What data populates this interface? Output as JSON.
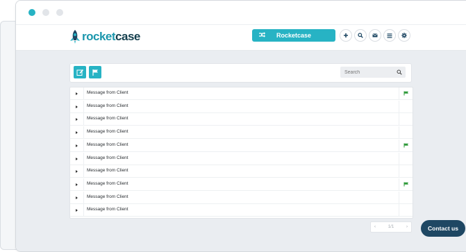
{
  "brand": {
    "logo_part1": "rocket",
    "logo_part2": "case",
    "accent": "#27b3c4",
    "dark": "#1e4763"
  },
  "header": {
    "switch_label": "Rocketcase",
    "icons": [
      "plus-icon",
      "search-icon",
      "mail-icon",
      "menu-icon",
      "gear-icon"
    ]
  },
  "toolbar": {
    "search_placeholder": "Search",
    "buttons": [
      "compose-icon",
      "flag-icon"
    ]
  },
  "messages": [
    {
      "subject": "Message from Client",
      "flagged": true
    },
    {
      "subject": "Message from Client",
      "flagged": false
    },
    {
      "subject": "Message from Client",
      "flagged": false
    },
    {
      "subject": "Message from Client",
      "flagged": false
    },
    {
      "subject": "Message from Client",
      "flagged": true
    },
    {
      "subject": "Message from Client",
      "flagged": false
    },
    {
      "subject": "Message from Client",
      "flagged": false
    },
    {
      "subject": "Message from Client",
      "flagged": true
    },
    {
      "subject": "Message from Client",
      "flagged": false
    },
    {
      "subject": "Message from Client",
      "flagged": false
    }
  ],
  "pager": {
    "page_label": "1/1"
  },
  "contact_label": "Contact us"
}
